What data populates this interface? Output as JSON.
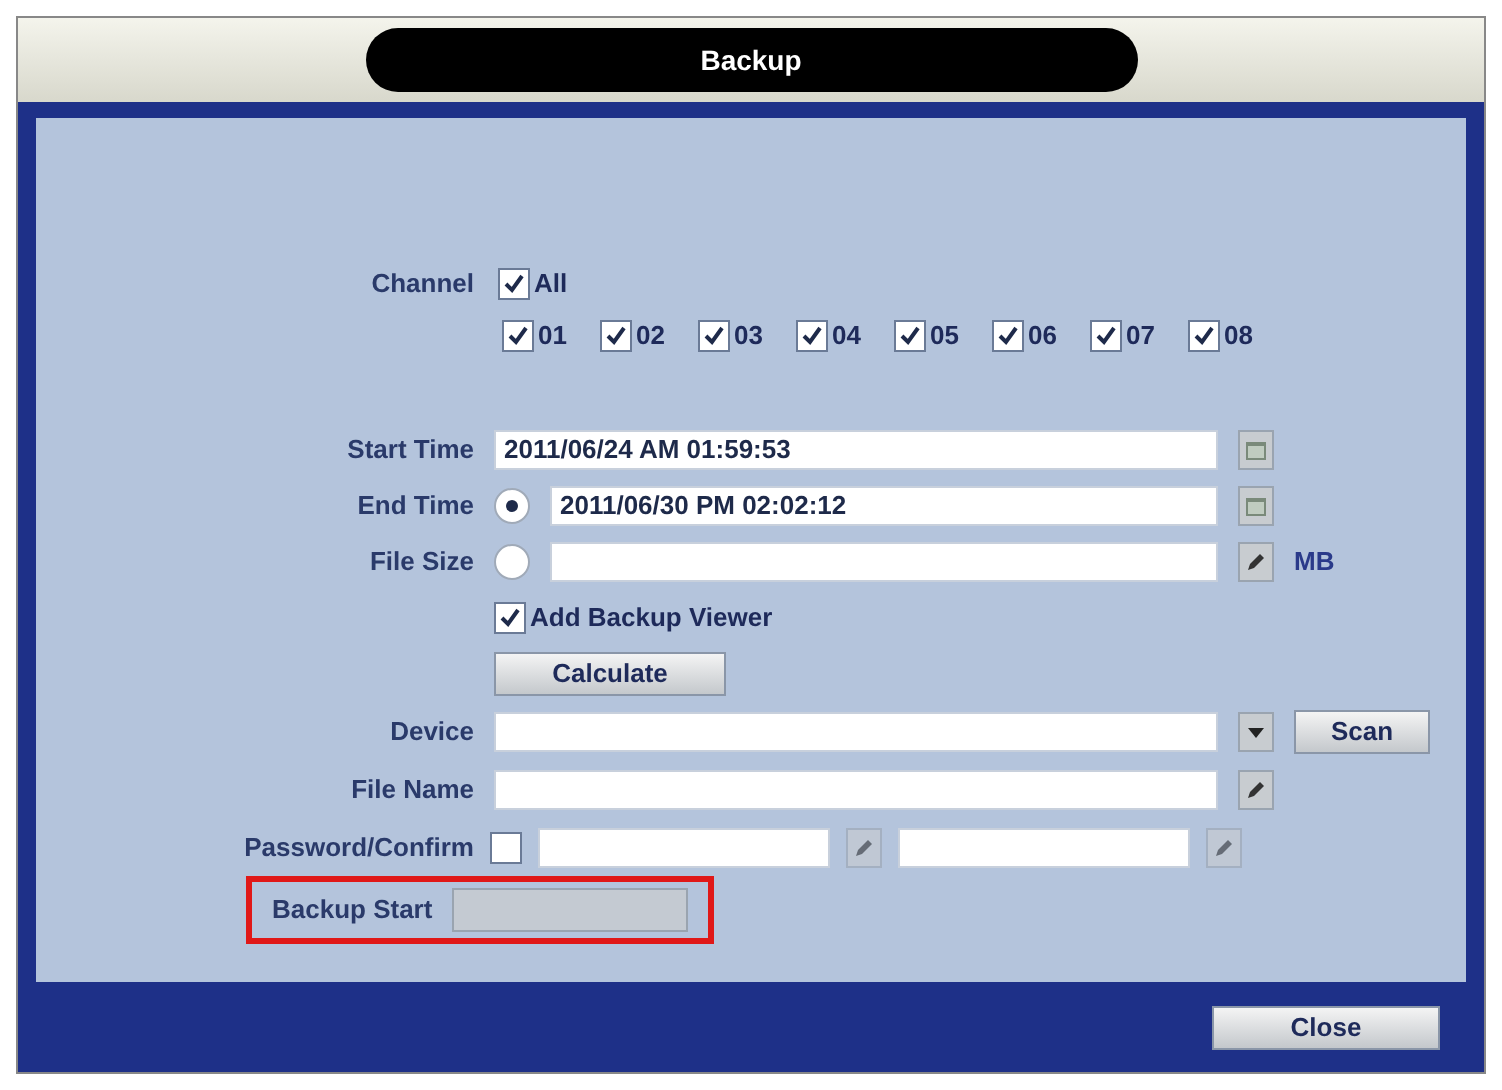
{
  "window": {
    "title": "Backup"
  },
  "channel": {
    "label": "Channel",
    "all": {
      "label": "All",
      "checked": true
    },
    "channels": [
      {
        "label": "01",
        "checked": true
      },
      {
        "label": "02",
        "checked": true
      },
      {
        "label": "03",
        "checked": true
      },
      {
        "label": "04",
        "checked": true
      },
      {
        "label": "05",
        "checked": true
      },
      {
        "label": "06",
        "checked": true
      },
      {
        "label": "07",
        "checked": true
      },
      {
        "label": "08",
        "checked": true
      }
    ]
  },
  "start_time": {
    "label": "Start Time",
    "value": "2011/06/24 AM 01:59:53"
  },
  "end_time": {
    "label": "End Time",
    "value": "2011/06/30 PM 02:02:12",
    "selected": true
  },
  "file_size": {
    "label": "File Size",
    "unit": "MB",
    "selected": false
  },
  "add_backup_viewer": {
    "label": "Add Backup Viewer",
    "checked": true
  },
  "calculate_button": "Calculate",
  "device": {
    "label": "Device",
    "scan_button": "Scan"
  },
  "file_name": {
    "label": "File Name"
  },
  "password": {
    "label": "Password/Confirm",
    "checked": false
  },
  "backup_start": {
    "label": "Backup Start",
    "disabled": true,
    "highlighted": true
  },
  "close_button": "Close"
}
